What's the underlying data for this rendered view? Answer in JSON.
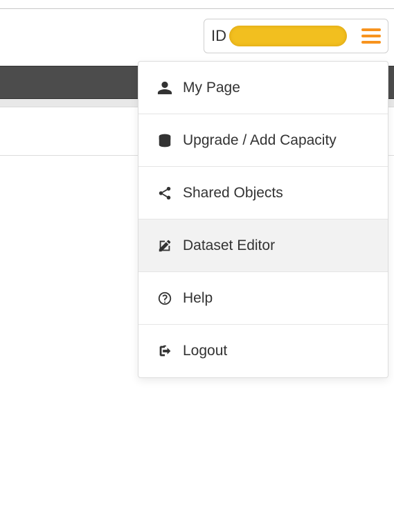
{
  "header": {
    "id_label": "ID"
  },
  "menu": {
    "items": [
      {
        "label": "My Page"
      },
      {
        "label": "Upgrade / Add Capacity"
      },
      {
        "label": "Shared Objects"
      },
      {
        "label": "Dataset Editor"
      },
      {
        "label": "Help"
      },
      {
        "label": "Logout"
      }
    ]
  }
}
